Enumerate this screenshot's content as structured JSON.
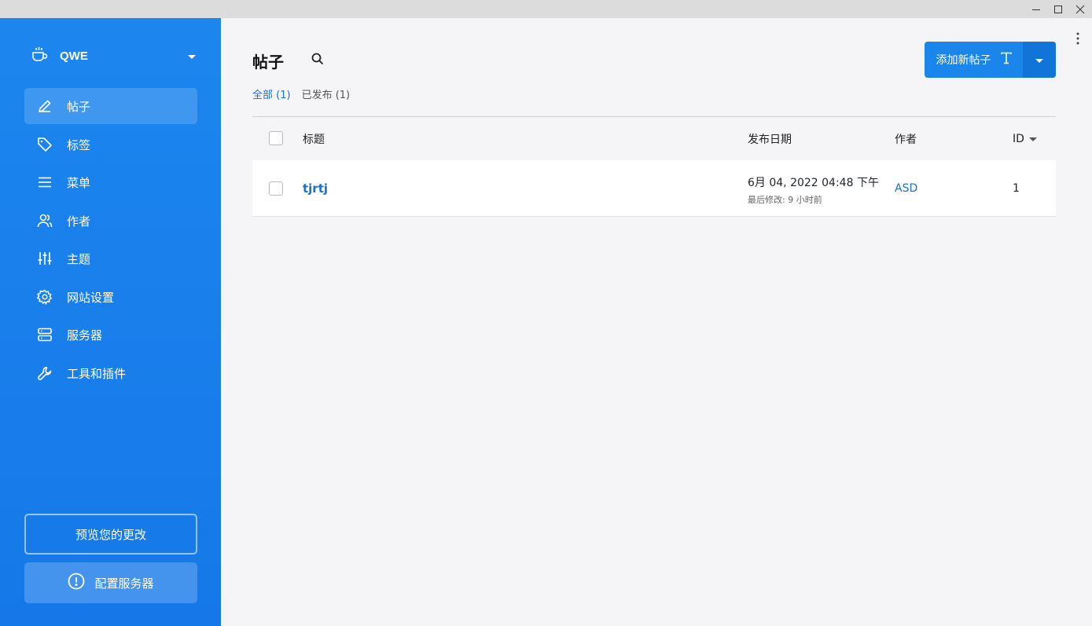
{
  "window": {
    "minimize_icon": "minimize-icon",
    "maximize_icon": "maximize-icon",
    "close_icon": "close-icon"
  },
  "sidebar": {
    "site_name": "QWE",
    "items": [
      {
        "label": "帖子",
        "icon": "pencil-icon",
        "active": true
      },
      {
        "label": "标签",
        "icon": "tag-icon"
      },
      {
        "label": "菜单",
        "icon": "menu-icon"
      },
      {
        "label": "作者",
        "icon": "users-icon"
      },
      {
        "label": "主题",
        "icon": "sliders-icon"
      },
      {
        "label": "网站设置",
        "icon": "gear-icon"
      },
      {
        "label": "服务器",
        "icon": "server-icon"
      },
      {
        "label": "工具和插件",
        "icon": "wrench-icon"
      }
    ],
    "preview_button": "预览您的更改",
    "config_button": "配置服务器"
  },
  "main": {
    "title": "帖子",
    "add_button": "添加新帖子",
    "filters": [
      {
        "label": "全部 (1)",
        "active": true
      },
      {
        "label": "已发布 (1)",
        "active": false
      }
    ],
    "columns": {
      "title": "标题",
      "date": "发布日期",
      "author": "作者",
      "id": "ID"
    },
    "rows": [
      {
        "title": "tjrtj",
        "date": "6月 04, 2022 04:48 下午",
        "modified": "最后修改: 9 小时前",
        "author": "ASD",
        "id": "1"
      }
    ]
  },
  "colors": {
    "accent": "#1a86ec",
    "sidebar": "#1c86ee",
    "link": "#1a6fd0"
  }
}
